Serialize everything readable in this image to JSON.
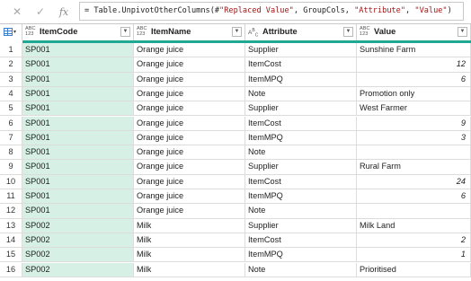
{
  "formula_bar": {
    "cancel_icon": "close-icon",
    "commit_icon": "check-icon",
    "fx_label": "fx",
    "formula_parts": [
      {
        "text": "= Table.UnpivotOtherColumns(#",
        "kind": "txt"
      },
      {
        "text": "\"Replaced Value\"",
        "kind": "str"
      },
      {
        "text": ", GroupCols, ",
        "kind": "txt"
      },
      {
        "text": "\"Attribute\"",
        "kind": "str"
      },
      {
        "text": ", ",
        "kind": "txt"
      },
      {
        "text": "\"Value\"",
        "kind": "str"
      },
      {
        "text": ")",
        "kind": "txt"
      }
    ]
  },
  "columns": [
    {
      "type": "ABC\n123",
      "name": "ItemCode"
    },
    {
      "type": "ABC\n123",
      "name": "ItemName"
    },
    {
      "type": "A B C",
      "name": "Attribute"
    },
    {
      "type": "ABC\n123",
      "name": "Value"
    }
  ],
  "colors": {
    "query_bar": "#1fa894",
    "selected_column": "#d6f0e5",
    "string_literal": "#a31515"
  },
  "rows": [
    {
      "n": "1",
      "code": "SP001",
      "name": "Orange juice",
      "attr": "Supplier",
      "value": "Sunshine Farm",
      "num": false
    },
    {
      "n": "2",
      "code": "SP001",
      "name": "Orange juice",
      "attr": "ItemCost",
      "value": "12",
      "num": true
    },
    {
      "n": "3",
      "code": "SP001",
      "name": "Orange juice",
      "attr": "ItemMPQ",
      "value": "6",
      "num": true
    },
    {
      "n": "4",
      "code": "SP001",
      "name": "Orange juice",
      "attr": "Note",
      "value": "Promotion only",
      "num": false
    },
    {
      "n": "5",
      "code": "SP001",
      "name": "Orange juice",
      "attr": "Supplier",
      "value": "West Farmer",
      "num": false
    },
    {
      "n": "6",
      "code": "SP001",
      "name": "Orange juice",
      "attr": "ItemCost",
      "value": "9",
      "num": true
    },
    {
      "n": "7",
      "code": "SP001",
      "name": "Orange juice",
      "attr": "ItemMPQ",
      "value": "3",
      "num": true
    },
    {
      "n": "8",
      "code": "SP001",
      "name": "Orange juice",
      "attr": "Note",
      "value": "",
      "num": false
    },
    {
      "n": "9",
      "code": "SP001",
      "name": "Orange juice",
      "attr": "Supplier",
      "value": "Rural Farm",
      "num": false
    },
    {
      "n": "10",
      "code": "SP001",
      "name": "Orange juice",
      "attr": "ItemCost",
      "value": "24",
      "num": true
    },
    {
      "n": "11",
      "code": "SP001",
      "name": "Orange juice",
      "attr": "ItemMPQ",
      "value": "6",
      "num": true
    },
    {
      "n": "12",
      "code": "SP001",
      "name": "Orange juice",
      "attr": "Note",
      "value": "",
      "num": false
    },
    {
      "n": "13",
      "code": "SP002",
      "name": "Milk",
      "attr": "Supplier",
      "value": "Milk Land",
      "num": false
    },
    {
      "n": "14",
      "code": "SP002",
      "name": "Milk",
      "attr": "ItemCost",
      "value": "2",
      "num": true
    },
    {
      "n": "15",
      "code": "SP002",
      "name": "Milk",
      "attr": "ItemMPQ",
      "value": "1",
      "num": true
    },
    {
      "n": "16",
      "code": "SP002",
      "name": "Milk",
      "attr": "Note",
      "value": "Prioritised",
      "num": false
    }
  ]
}
